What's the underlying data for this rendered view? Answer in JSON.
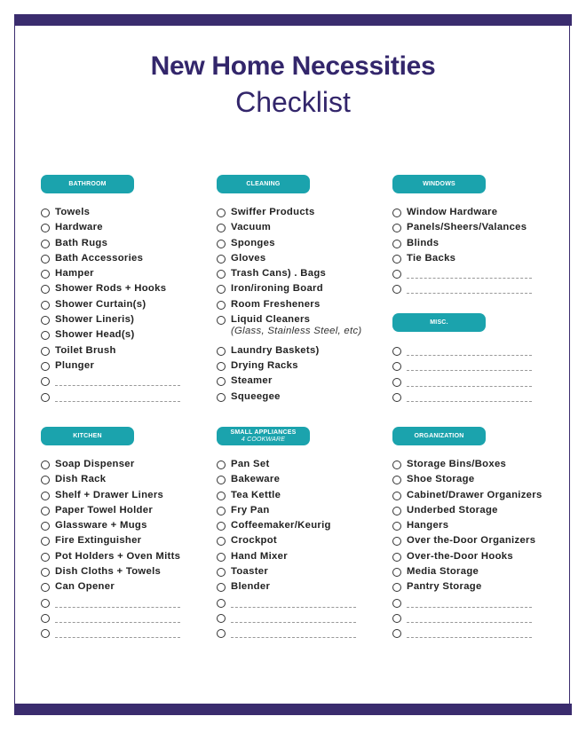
{
  "title": "New Home Necessities",
  "subtitle": "Checklist",
  "colors": {
    "frame": "#3a2c6e",
    "pill": "#1ba3ad",
    "title": "#33266b"
  },
  "sections": [
    {
      "id": "bathroom",
      "label": "BATHROOM",
      "items": [
        {
          "text": "Towels"
        },
        {
          "text": "Hardware"
        },
        {
          "text": "Bath Rugs"
        },
        {
          "text": "Bath Accessories"
        },
        {
          "text": "Hamper"
        },
        {
          "text": "Shower Rods + Hooks"
        },
        {
          "text": "Shower Curtain(s)"
        },
        {
          "text": "Shower Lineris)"
        },
        {
          "text": "Shower Head(s)"
        },
        {
          "text": "Toilet Brush"
        },
        {
          "text": "Plunger"
        },
        {
          "text": ""
        },
        {
          "text": ""
        }
      ]
    },
    {
      "id": "cleaning",
      "label": "CLEANING",
      "items": [
        {
          "text": "Swiffer Products"
        },
        {
          "text": "Vacuum"
        },
        {
          "text": "Sponges"
        },
        {
          "text": "Gloves"
        },
        {
          "text": "Trash Cans) . Bags"
        },
        {
          "text": "Iron/ironing Board"
        },
        {
          "text": "Room Fresheners"
        },
        {
          "text": "Liquid Cleaners",
          "note": "(Glass, Stainless Steel, etc)"
        },
        {
          "text": "Laundry Baskets)"
        },
        {
          "text": "Drying Racks"
        },
        {
          "text": "Steamer"
        },
        {
          "text": "Squeegee"
        }
      ]
    },
    {
      "id": "windows",
      "label": "WINDOWS",
      "items": [
        {
          "text": "Window Hardware"
        },
        {
          "text": "Panels/Sheers/Valances"
        },
        {
          "text": "Blinds"
        },
        {
          "text": "Tie Backs"
        },
        {
          "text": ""
        },
        {
          "text": ""
        }
      ]
    },
    {
      "id": "misc",
      "label": "MISC.",
      "items": [
        {
          "text": ""
        },
        {
          "text": ""
        },
        {
          "text": ""
        },
        {
          "text": ""
        }
      ]
    },
    {
      "id": "kitchen",
      "label": "KITCHEN",
      "items": [
        {
          "text": "Soap Dispenser"
        },
        {
          "text": "Dish Rack"
        },
        {
          "text": "Shelf + Drawer Liners"
        },
        {
          "text": "Paper Towel Holder"
        },
        {
          "text": "Glassware + Mugs"
        },
        {
          "text": "Fire Extinguisher"
        },
        {
          "text": "Pot Holders + Oven Mitts"
        },
        {
          "text": "Dish Cloths + Towels"
        },
        {
          "text": "Can Opener"
        },
        {
          "text": ""
        },
        {
          "text": ""
        },
        {
          "text": ""
        }
      ]
    },
    {
      "id": "small-appliances",
      "label": "SMALL APPLIANCES",
      "sublabel": "4 COOKWARE",
      "items": [
        {
          "text": "Pan Set"
        },
        {
          "text": "Bakeware"
        },
        {
          "text": "Tea Kettle"
        },
        {
          "text": "Fry Pan"
        },
        {
          "text": "Coffeemaker/Keurig"
        },
        {
          "text": "Crockpot"
        },
        {
          "text": "Hand Mixer"
        },
        {
          "text": "Toaster"
        },
        {
          "text": "Blender"
        },
        {
          "text": ""
        },
        {
          "text": ""
        },
        {
          "text": ""
        }
      ]
    },
    {
      "id": "organization",
      "label": "ORGANIZATION",
      "items": [
        {
          "text": "Storage Bins/Boxes"
        },
        {
          "text": "Shoe Storage"
        },
        {
          "text": "Cabinet/Drawer Organizers"
        },
        {
          "text": "Underbed Storage"
        },
        {
          "text": "Hangers"
        },
        {
          "text": "Over the-Door Organizers"
        },
        {
          "text": "Over-the-Door Hooks"
        },
        {
          "text": "Media Storage"
        },
        {
          "text": "Pantry Storage"
        },
        {
          "text": ""
        },
        {
          "text": ""
        },
        {
          "text": ""
        }
      ]
    }
  ]
}
